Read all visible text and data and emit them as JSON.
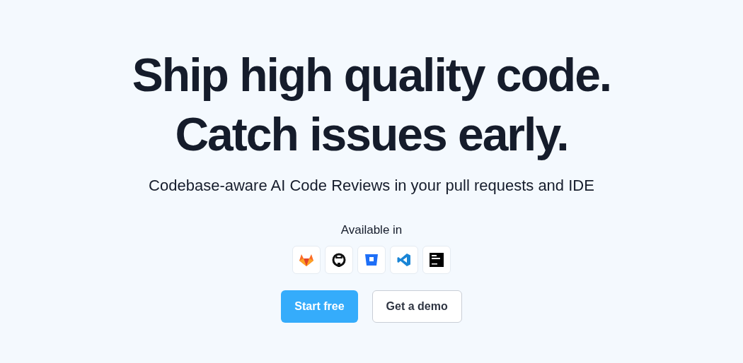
{
  "headline": [
    "Ship high quality code.",
    "Catch issues early."
  ],
  "subtitle": "Codebase-aware AI Code Reviews in your pull requests and IDE",
  "available": {
    "label": "Available in",
    "platforms": [
      {
        "kind": "gitlab"
      },
      {
        "kind": "github"
      },
      {
        "kind": "bitbucket"
      },
      {
        "kind": "vscode"
      },
      {
        "kind": "jetbrains"
      }
    ]
  },
  "buttons": [
    {
      "label": "Start free",
      "kind": "primary"
    },
    {
      "label": "Get a demo",
      "kind": "secondary"
    }
  ]
}
